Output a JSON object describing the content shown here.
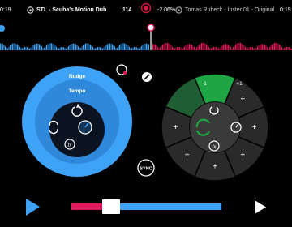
{
  "deck_left": {
    "elapsed_time": "0:19",
    "track_title": "STL - Scuba's Motion Dub",
    "bpm": "114",
    "color": "#3ea2f6"
  },
  "deck_right": {
    "pitch": "-2.06%",
    "track_title": "Tomas Rubeck - Inster 01 - Original...",
    "remaining_time": "0:19",
    "color": "#e2185b"
  },
  "wheel": {
    "nudge_label": "Nudge",
    "tempo_label": "Tempo",
    "icons": [
      "loop-icon",
      "sync-arrows-icon",
      "gauge-icon",
      "fx-icon"
    ]
  },
  "pads": {
    "loop_minus_label": "-1",
    "loop_plus_label": "+1",
    "accent_color": "#1ea544",
    "add_label": "+"
  },
  "sync_button": {
    "label": "SYNC"
  },
  "crossfader": {
    "position": 0.31,
    "left_color": "#e2185b",
    "right_color": "#3ea2f6"
  },
  "transport": {
    "left_play": "play-icon",
    "right_play": "play-icon"
  }
}
